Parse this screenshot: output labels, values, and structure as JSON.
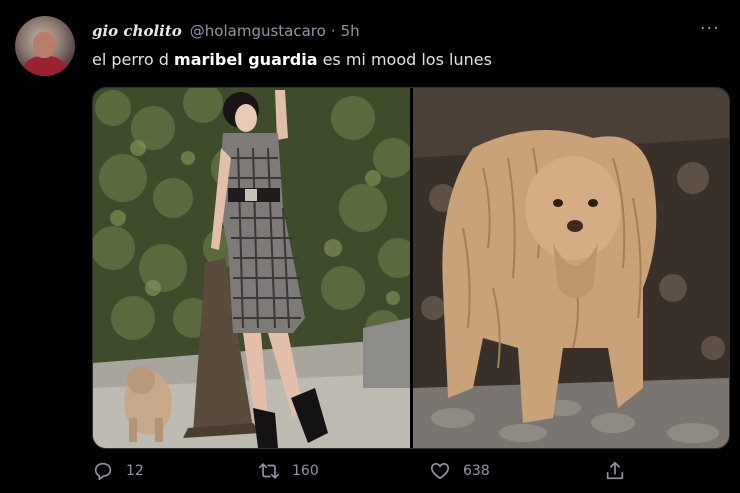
{
  "tweet": {
    "display_name": "gio cholito",
    "handle": "@holamgustacaro",
    "separator": "·",
    "time": "5h",
    "more": "···",
    "text_before": "el perro d ",
    "text_bold": "maribel guardia",
    "text_after": " es mi mood los lunes"
  },
  "actions": {
    "reply_count": "12",
    "retweet_count": "160",
    "like_count": "638"
  },
  "colors": {
    "background": "#000000",
    "secondary_text": "#8b98a5",
    "primary_text": "#e1e1e1"
  },
  "icons": [
    "reply-icon",
    "retweet-icon",
    "like-icon",
    "share-icon",
    "more-icon"
  ]
}
